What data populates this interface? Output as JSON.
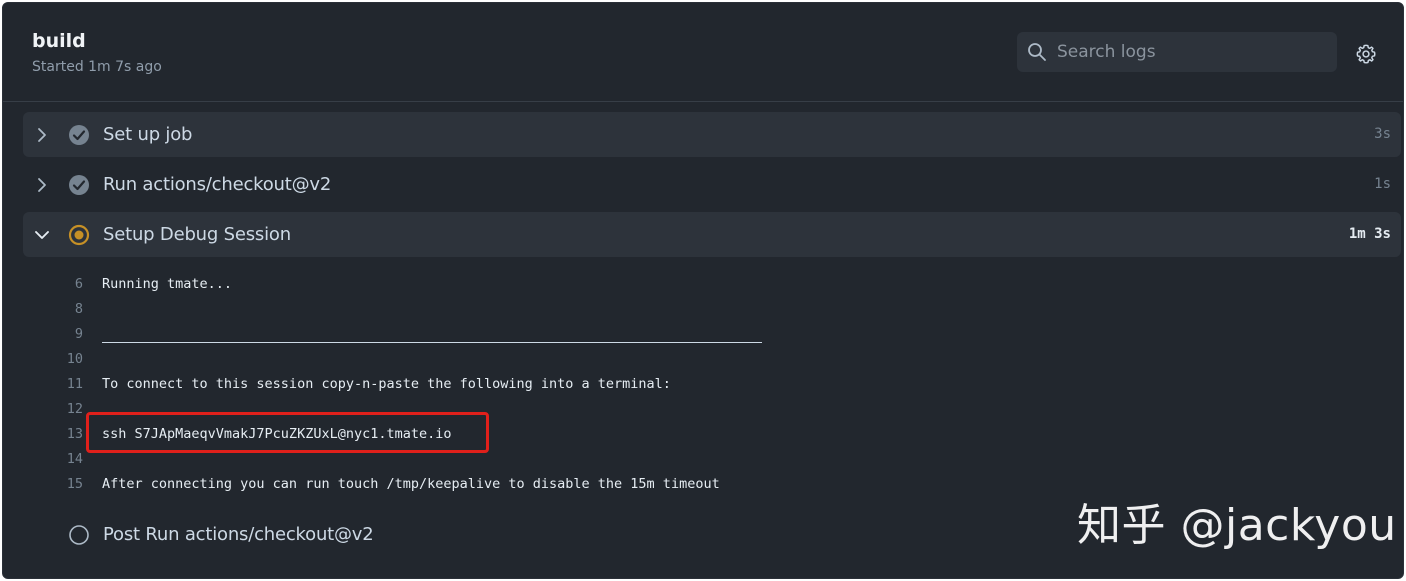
{
  "header": {
    "title": "build",
    "subtitle": "Started 1m 7s ago",
    "search_placeholder": "Search logs",
    "search_value": ""
  },
  "steps": [
    {
      "name": "Set up job",
      "time": "3s",
      "status": "success",
      "expanded": false
    },
    {
      "name": "Run actions/checkout@v2",
      "time": "1s",
      "status": "success",
      "expanded": false
    },
    {
      "name": "Setup Debug Session",
      "time": "1m 3s",
      "status": "in-progress",
      "expanded": true
    },
    {
      "name": "Post Run actions/checkout@v2",
      "time": "",
      "status": "pending",
      "expanded": false
    }
  ],
  "log": [
    {
      "n": "6",
      "text": "Running tmate..."
    },
    {
      "n": "8",
      "text": ""
    },
    {
      "n": "9",
      "text": ""
    },
    {
      "n": "10",
      "text": ""
    },
    {
      "n": "11",
      "text": "To connect to this session copy-n-paste the following into a terminal:"
    },
    {
      "n": "12",
      "text": ""
    },
    {
      "n": "13",
      "text": "ssh S7JApMaeqvVmakJ7PcuZKZUxL@nyc1.tmate.io"
    },
    {
      "n": "14",
      "text": ""
    },
    {
      "n": "15",
      "text": "After connecting you can run touch /tmp/keepalive to disable the 15m timeout"
    }
  ],
  "watermark": "知乎 @jackyou",
  "colors": {
    "background": "#22272e",
    "step_bg": "#2d333b",
    "success": "#768390",
    "in_progress": "#c69026",
    "highlight": "#e0201b"
  },
  "icons": [
    "search-icon",
    "gear-icon",
    "chevron-right-icon",
    "chevron-down-icon",
    "check-circle-icon",
    "in-progress-icon",
    "pending-circle-icon"
  ]
}
